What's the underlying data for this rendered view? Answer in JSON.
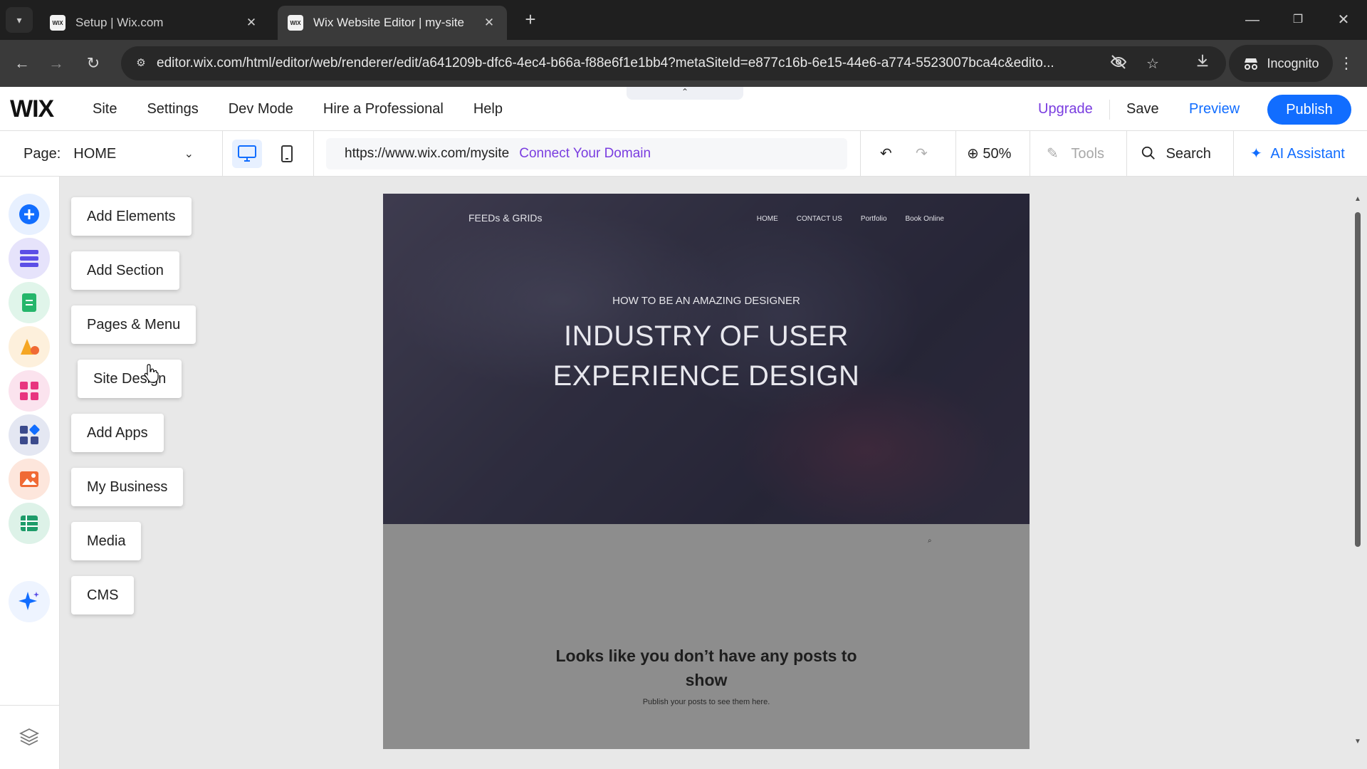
{
  "browser": {
    "tabs": [
      {
        "title": "Setup | Wix.com",
        "active": false
      },
      {
        "title": "Wix Website Editor | my-site",
        "active": true
      }
    ],
    "url": "editor.wix.com/html/editor/web/renderer/edit/a641209b-dfc6-4ec4-b66a-f88e6f1e1bb4?metaSiteId=e877c16b-6e15-44e6-a774-5523007bca4c&edito...",
    "incognito_label": "Incognito"
  },
  "wix": {
    "logo": "WIX",
    "menu": [
      "Site",
      "Settings",
      "Dev Mode",
      "Hire a Professional",
      "Help"
    ],
    "upgrade": "Upgrade",
    "save": "Save",
    "preview": "Preview",
    "publish": "Publish",
    "accent": "#116dff",
    "upgrade_color": "#7a3de0"
  },
  "toolbar": {
    "page_label": "Page:",
    "page_value": "HOME",
    "site_url": "https://www.wix.com/mysite",
    "connect_domain": "Connect Your Domain",
    "zoom": "50%",
    "tools": "Tools",
    "search": "Search",
    "ai_assistant": "AI Assistant"
  },
  "sidebar": {
    "items": [
      {
        "label": "Add Elements",
        "icon": "plus-icon",
        "color": "#116dff"
      },
      {
        "label": "Add Section",
        "icon": "section-icon",
        "color": "#5b4ee6"
      },
      {
        "label": "Pages & Menu",
        "icon": "page-icon",
        "color": "#25b66b"
      },
      {
        "label": "Site Design",
        "icon": "design-icon",
        "color": "#f5a623"
      },
      {
        "label": "Add Apps",
        "icon": "apps-icon",
        "color": "#e8357f"
      },
      {
        "label": "My Business",
        "icon": "business-icon",
        "color": "#3b4a8c"
      },
      {
        "label": "Media",
        "icon": "media-icon",
        "color": "#f06a35"
      },
      {
        "label": "CMS",
        "icon": "cms-icon",
        "color": "#1e9c6a"
      }
    ]
  },
  "site": {
    "name": "FEEDs & GRIDs",
    "nav": [
      "HOME",
      "CONTACT US",
      "Portfolio",
      "Book Online"
    ],
    "kicker": "HOW TO BE AN AMAZING DESIGNER",
    "title_line1": "INDUSTRY OF USER",
    "title_line2": "EXPERIENCE DESIGN",
    "empty_title_line1": "Looks like you don’t have any posts to",
    "empty_title_line2": "show",
    "empty_sub": "Publish your posts to see them here."
  }
}
